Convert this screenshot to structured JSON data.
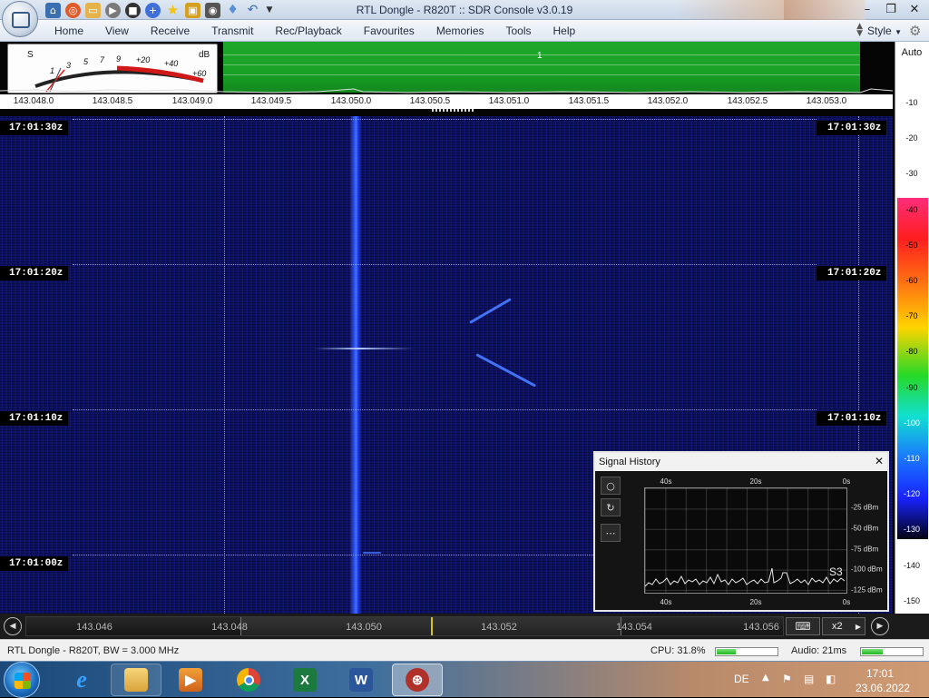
{
  "window": {
    "title": "RTL Dongle - R820T :: SDR Console v3.0.19",
    "controls": [
      "–",
      "❐",
      "✕"
    ]
  },
  "quick_access": [
    "home-icon",
    "help-ring-icon",
    "folder-icon",
    "play-icon",
    "stop-icon",
    "add-icon",
    "star-icon",
    "lock-icon",
    "camera-icon",
    "drop-icon",
    "undo-icon",
    "dropdown-icon"
  ],
  "ribbon": {
    "tabs": [
      "Home",
      "View",
      "Receive",
      "Transmit",
      "Rec/Playback",
      "Favourites",
      "Memories",
      "Tools",
      "Help"
    ],
    "style_label": "Style"
  },
  "smeter": {
    "s_label": "S",
    "db_label": "dB",
    "scale": [
      "1",
      "3",
      "5",
      "7",
      "9",
      "+20",
      "+40",
      "+60"
    ]
  },
  "spectrum": {
    "marker": "1",
    "freq_ticks": [
      "143.048.0",
      "143.048.5",
      "143.049.0",
      "143.049.5",
      "143.050.0",
      "143.050.5",
      "143.051.0",
      "143.051.5",
      "143.052.0",
      "143.052.5",
      "143.053.0"
    ]
  },
  "db_scale": {
    "auto_label": "Auto",
    "ticks": [
      "-10",
      "-20",
      "-30",
      "-40",
      "-50",
      "-60",
      "-70",
      "-80",
      "-90",
      "-100",
      "-110",
      "-120",
      "-130",
      "-140",
      "-150"
    ]
  },
  "waterfall": {
    "times": [
      "17:01:30z",
      "17:01:20z",
      "17:01:10z",
      "17:01:00z"
    ]
  },
  "signal_history": {
    "title": "Signal History",
    "close": "✕",
    "x_labels": [
      "40s",
      "20s",
      "0s"
    ],
    "y_labels": [
      "-25 dBm",
      "-50 dBm",
      "-75 dBm",
      "-100 dBm",
      "-125 dBm"
    ],
    "s_reading": "S3",
    "buttons": [
      "○",
      "↻",
      "⋯"
    ]
  },
  "freq_scroll": {
    "labels": [
      "143.046",
      "143.048",
      "143.050",
      "143.052",
      "143.054",
      "143.056"
    ],
    "zoom": "x2",
    "keyboard_icon": "⌨"
  },
  "status": {
    "left": "RTL Dongle - R820T, BW = 3.000 MHz",
    "cpu": "CPU: 31.8%",
    "audio": "Audio: 21ms",
    "cpu_fraction": 0.318,
    "audio_fraction": 0.35
  },
  "taskbar": {
    "apps": [
      "ie",
      "explorer",
      "media-player",
      "chrome",
      "excel",
      "word",
      "sdr-console"
    ],
    "lang": "DE",
    "time": "17:01",
    "date": "23.06.2022"
  },
  "colors": {
    "spectrum_green": "#1ea82a",
    "waterfall_blue": "#0c1170",
    "carrier_blue": "#4670ff"
  }
}
